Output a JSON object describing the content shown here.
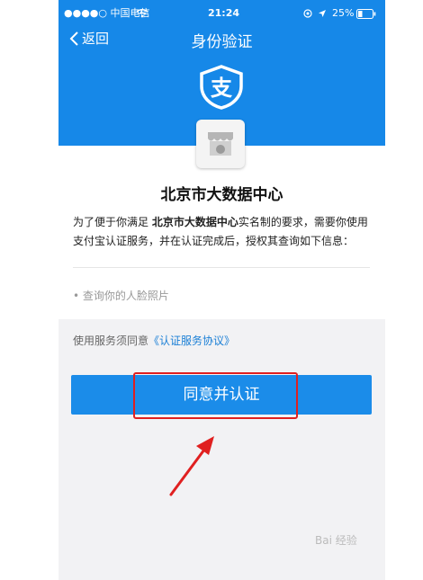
{
  "status_bar": {
    "carrier": "●●●●○ 中国电信",
    "time": "21:24",
    "battery": "25%"
  },
  "nav": {
    "back_label": "返回",
    "title": "身份验证"
  },
  "card": {
    "org_name": "北京市大数据中心",
    "desc_prefix": "为了便于你满足 ",
    "desc_org": "北京市大数据中心",
    "desc_suffix": "实名制的要求，需要你使用支付宝认证服务，并在认证完成后，授权其查询如下信息：",
    "permission_item": "• 查询你的人脸照片"
  },
  "agreement": {
    "prefix": "使用服务须同意",
    "link": "《认证服务协议》"
  },
  "cta_label": "同意并认证",
  "watermark": "Bai 经验",
  "colors": {
    "brand_blue": "#1688e8",
    "button_blue": "#1b8ce9",
    "annotation_red": "#e02020"
  },
  "icons": [
    "wifi-icon",
    "location-icon",
    "battery-icon",
    "back-chevron-icon",
    "alipay-shield-icon",
    "store-icon",
    "arrow-annotation"
  ]
}
